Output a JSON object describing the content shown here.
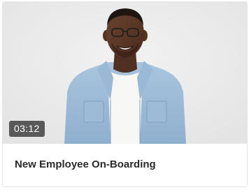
{
  "card": {
    "title": "New Employee On-Boarding",
    "duration": "03:12",
    "thumbnail": "video-thumbnail-smiling-man-denim-shirt"
  },
  "colors": {
    "thumbnail_background": "#ebebeb",
    "badge_background": "#464646",
    "badge_text": "#ffffff",
    "title_text": "#2b2b2b"
  }
}
